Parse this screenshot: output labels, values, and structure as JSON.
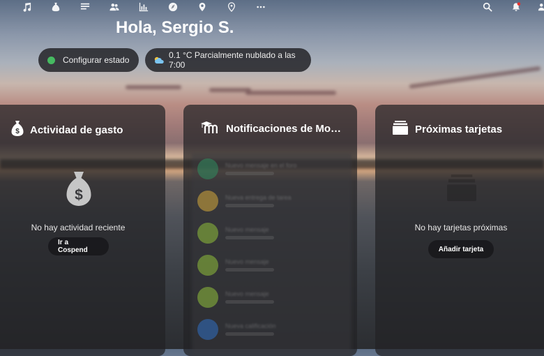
{
  "topbar": {
    "icons": [
      "music-icon",
      "money-bag-icon",
      "notes-icon",
      "contacts-icon",
      "chart-icon",
      "compass-icon",
      "map-pin-icon",
      "maps-icon",
      "more-icon"
    ],
    "right_icons": [
      "search-icon",
      "notifications-icon",
      "contacts-menu-icon"
    ],
    "notification_badge_color": "#e9322d"
  },
  "greeting": "Hola, Sergio S.",
  "status": {
    "label": "Configurar estado",
    "dot_color": "#46ba61"
  },
  "weather": {
    "text": "0.1 °C Parcialmente nublado a las 7:00",
    "icon": "partly-cloudy-icon"
  },
  "cards": {
    "spending": {
      "title": "Actividad de gasto",
      "icon": "money-bag-icon",
      "empty_text": "No hay actividad reciente",
      "button": "Ir a Cospend"
    },
    "moodle": {
      "title": "Notificaciones de Mo…",
      "icon": "moodle-icon",
      "items": [
        {
          "avatar_color": "#2f8d5f",
          "text": "Nuevo mensaje en el foro"
        },
        {
          "avatar_color": "#d6a93a",
          "text": "Nueva entrega de tarea"
        },
        {
          "avatar_color": "#8fbf3a",
          "text": "Nuevo mensaje"
        },
        {
          "avatar_color": "#8fbf3a",
          "text": "Nuevo mensaje"
        },
        {
          "avatar_color": "#8fbf3a",
          "text": "Nuevo mensaje"
        },
        {
          "avatar_color": "#2f6fc2",
          "text": "Nueva calificación"
        }
      ]
    },
    "deck": {
      "title": "Próximas tarjetas",
      "icon": "deck-icon",
      "empty_text": "No hay tarjetas próximas",
      "button": "Añadir tarjeta"
    }
  }
}
